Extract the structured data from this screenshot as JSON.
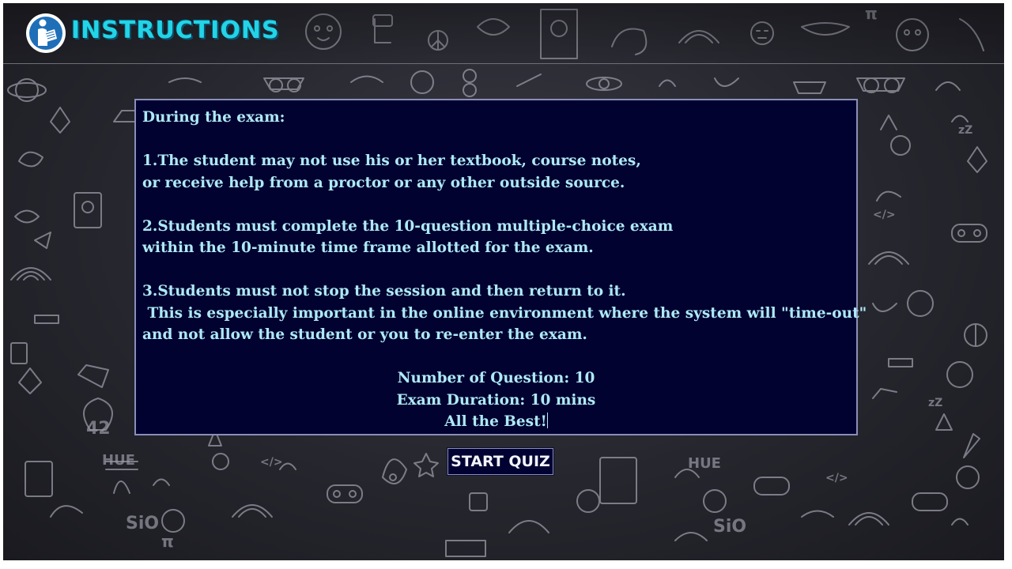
{
  "header": {
    "title": "INSTRUCTIONS",
    "icon": "reader-icon",
    "accent_color": "#22d4e6"
  },
  "instructions": {
    "intro": "During the exam:",
    "rule1_line1": "1.The student may not use his or her textbook, course notes,",
    "rule1_line2": "or receive help from a proctor or any other outside source.",
    "rule2_line1": "2.Students must complete the 10-question multiple-choice exam",
    "rule2_line2": "within the 10-minute time frame allotted for the exam.",
    "rule3_line1": "3.Students must not stop the session and then return to it.",
    "rule3_line2": " This is especially important in the online environment where the system will \"time-out\"",
    "rule3_line3": "and not allow the student or you to re-enter the exam.",
    "num_questions": "Number of Question: 10",
    "duration": "Exam Duration: 10 mins",
    "closing": "All the Best!"
  },
  "actions": {
    "start_label": "START QUIZ"
  },
  "colors": {
    "panel_bg": "#010230",
    "text": "#aee9f6",
    "button_bg": "#020232"
  }
}
